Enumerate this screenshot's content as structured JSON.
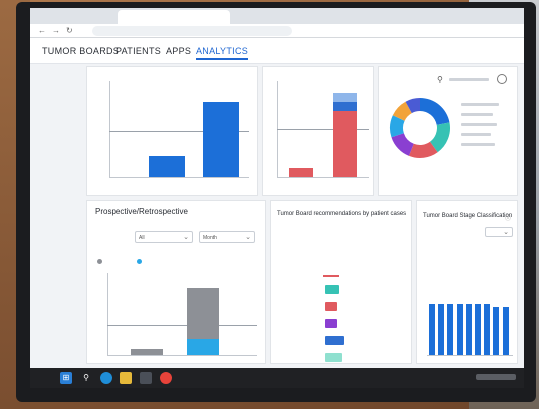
{
  "browser": {
    "tab_title": "",
    "url": "",
    "back_icon": "arrow-left-icon",
    "forward_icon": "arrow-right-icon",
    "reload_icon": "reload-icon"
  },
  "app_nav": {
    "items": [
      "TUMOR BOARDS",
      "PATIENTS",
      "APPS",
      "ANALYTICS"
    ],
    "active": "ANALYTICS"
  },
  "panels": {
    "prospective": {
      "title": "Prospective/Retrospective",
      "x_axis_label": "",
      "x_axis_value": "All",
      "y_axis_label": "",
      "y_axis_value": "Month",
      "measure_label": "",
      "legend": [
        "",
        ""
      ]
    },
    "recommendations": {
      "title": "Tumor Board recommendations by patient cases",
      "subtitle_1": "",
      "subtitle_2": "",
      "categories": [
        "",
        "",
        "",
        "",
        ""
      ],
      "values": [
        "",
        "",
        "",
        "",
        ""
      ]
    },
    "stage": {
      "title": "Tumor Board Stage Classification"
    }
  },
  "colors": {
    "blue": "#1c6fd8",
    "red": "#e05a5f",
    "teal": "#36c2b4",
    "gray": "#8d9096",
    "purple": "#8a3fd1",
    "cyan": "#29a7e6"
  },
  "chart_data": [
    {
      "type": "bar",
      "categories": [
        "",
        ""
      ],
      "values": [
        1,
        3.5
      ],
      "ylim": [
        0,
        4.5
      ],
      "grid": false
    },
    {
      "type": "bar",
      "stacked": true,
      "categories": [
        "",
        ""
      ],
      "series": [
        {
          "values": [
            0.3,
            2.2
          ]
        },
        {
          "values": [
            0,
            0.3
          ]
        },
        {
          "values": [
            0,
            0.3
          ]
        }
      ],
      "ylim": [
        0,
        3.2
      ],
      "grid": false
    },
    {
      "type": "pie",
      "donut": true,
      "values": [
        22,
        18,
        16,
        14,
        12,
        10,
        8
      ]
    },
    {
      "type": "bar",
      "stacked": true,
      "categories": [
        "",
        ""
      ],
      "series": [
        {
          "name": "",
          "values": [
            0,
            1.8
          ]
        },
        {
          "name": "",
          "values": [
            0.7,
            5.5
          ]
        }
      ],
      "ylim": [
        0,
        9
      ],
      "grid": false
    },
    {
      "type": "bar",
      "horizontal": true,
      "categories": [
        "",
        "",
        "",
        "",
        ""
      ],
      "values": [
        6,
        5,
        5,
        8,
        7
      ],
      "xlim": [
        0,
        10
      ]
    },
    {
      "type": "bar",
      "categories": [
        "",
        "",
        "",
        "",
        "",
        "",
        "",
        "",
        ""
      ],
      "values": [
        0.9,
        0.9,
        0.9,
        0.9,
        0.9,
        0.9,
        0.9,
        0.85,
        0.85
      ],
      "ylim": [
        0,
        1.1
      ]
    }
  ]
}
